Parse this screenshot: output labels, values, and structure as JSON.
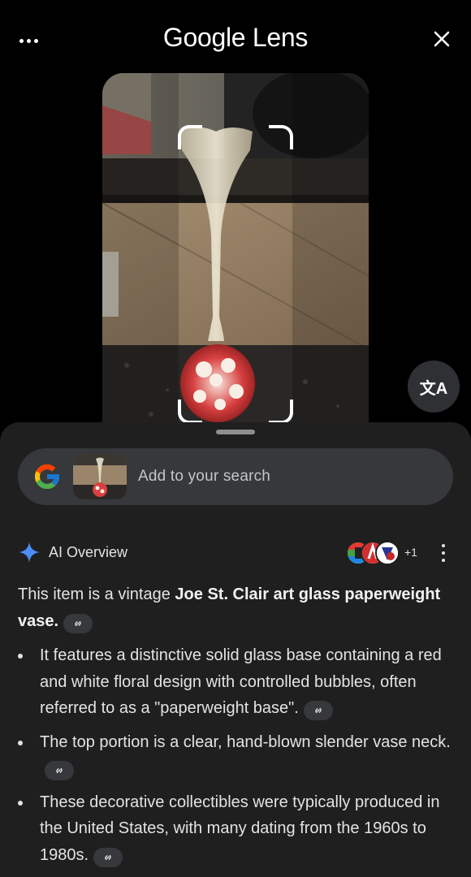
{
  "header": {
    "title": "Google Lens",
    "more_icon": "more-horizontal-icon",
    "close_icon": "close-icon"
  },
  "translate_button": {
    "icon": "translate-icon",
    "glyph": "文A"
  },
  "search": {
    "placeholder": "Add to your search",
    "logo": "google-g-logo"
  },
  "ai_overview": {
    "title": "AI Overview",
    "sources_extra": "+1",
    "intro_prefix": "This item is a vintage ",
    "intro_bold": "Joe St. Clair art glass paperweight vase.",
    "points": [
      "It features a distinctive solid glass base containing a red and white floral design with controlled bubbles, often referred to as a \"paperweight base\".",
      "The top portion is a clear, hand-blown slender vase neck.",
      "These decorative collectibles were typically produced in the United States, with many dating from the 1960s to 1980s."
    ]
  },
  "colors": {
    "background": "#000000",
    "sheet": "#1f1f1f",
    "search_bar": "#36383b",
    "text": "#e3e3e3",
    "sparkle": "#4c8df6"
  }
}
